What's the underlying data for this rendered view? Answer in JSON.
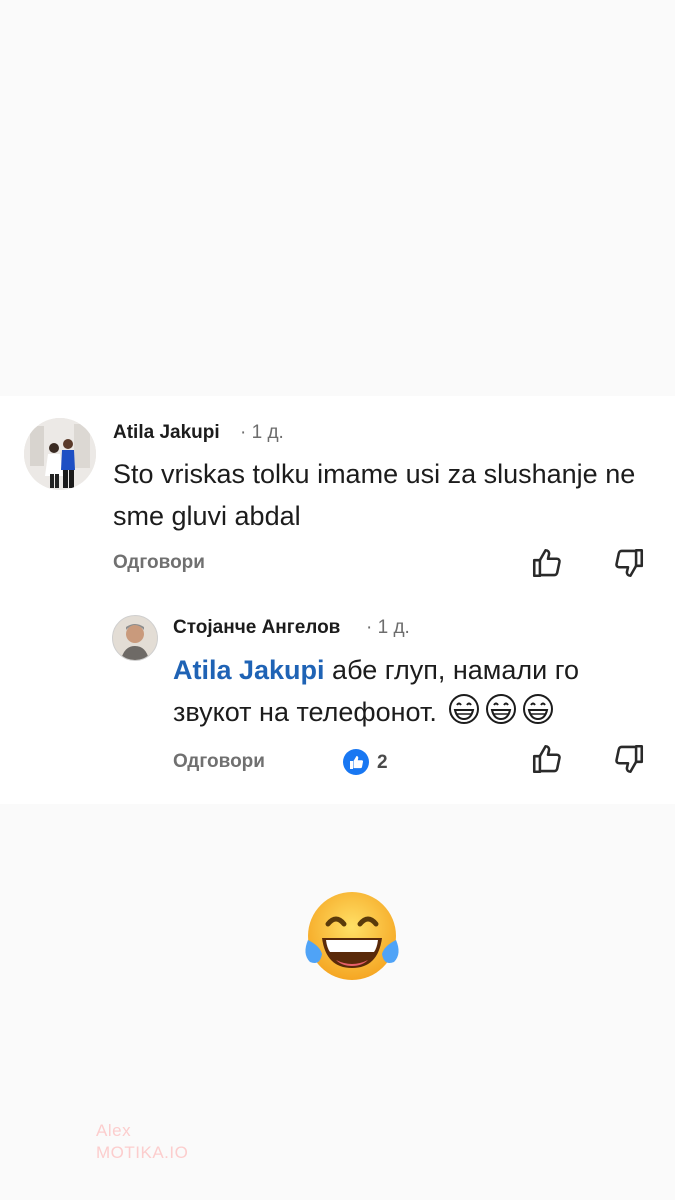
{
  "comment": {
    "author": "Atila Jakupi",
    "time": "· 1 д.",
    "text": "Sto vriskas tolku imame usi za slushanje ne sme gluvi abdal",
    "reply_label": "Одговори"
  },
  "reply": {
    "author": "Стојанче Ангелов",
    "time": "· 1 д.",
    "mention": "Atila Jakupi",
    "text": " абе глуп, намали го звукот на телефонот.",
    "reply_label": "Одговори",
    "like_count": "2"
  },
  "watermark": {
    "line1": "Alex",
    "line2": "MOTIKA.IO"
  },
  "colors": {
    "mention": "#1f63b5",
    "like_badge": "#1877f2"
  },
  "icons": [
    "thumbs-up-icon",
    "thumbs-down-icon",
    "like-reaction-icon",
    "grinning-face-emoji",
    "laughing-tears-emoji"
  ]
}
